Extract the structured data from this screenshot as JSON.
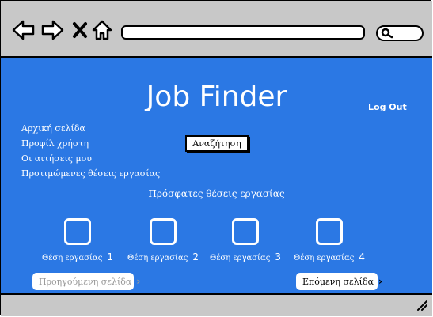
{
  "app": {
    "title": "Job Finder",
    "logout_label": "Log Out"
  },
  "menu": {
    "items": [
      {
        "label": "Αρχική σελίδα"
      },
      {
        "label": "Προφίλ χρήστη"
      },
      {
        "label": "Οι αιτήσεις μου"
      },
      {
        "label": "Προτιμώμενες θέσεις εργασίας"
      }
    ]
  },
  "search": {
    "label": "Αναζήτηση"
  },
  "recent": {
    "heading": "Πρόσφατες θέσεις εργασίας",
    "jobs": [
      {
        "label": "Θέση εργασίας",
        "number": "1"
      },
      {
        "label": "Θέση εργασίας",
        "number": "2"
      },
      {
        "label": "Θέση εργασίας",
        "number": "3"
      },
      {
        "label": "Θέση εργασίας",
        "number": "4"
      }
    ]
  },
  "pagination": {
    "prev_label": "Προηγούμενη σελίδα",
    "next_label": "Επόμενη σελίδα"
  },
  "colors": {
    "content_bg": "#2b78e4",
    "chrome_bg": "#c8c8c8"
  },
  "icons": [
    "back-arrow-icon",
    "forward-arrow-icon",
    "close-icon",
    "home-icon",
    "search-icon",
    "chevron-right-icon",
    "resize-grip-icon"
  ]
}
